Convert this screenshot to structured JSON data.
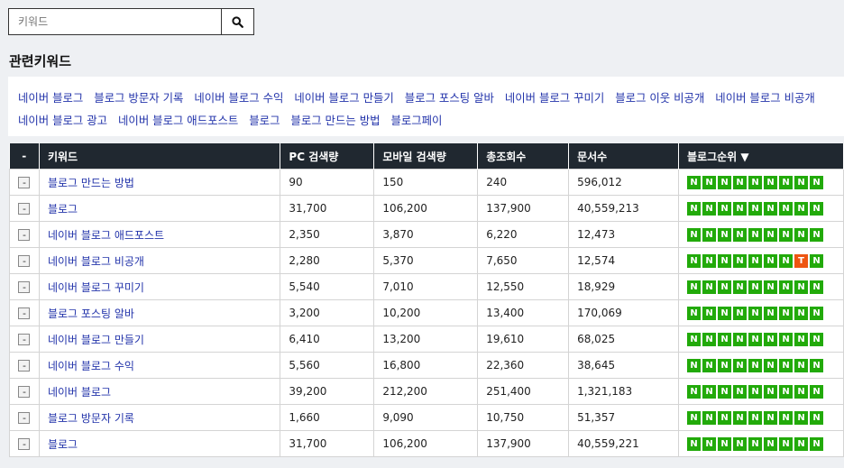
{
  "search": {
    "placeholder": "키워드",
    "button_icon": "search-icon"
  },
  "section_title": "관련키워드",
  "related_keywords": [
    "네이버 블로그",
    "블로그 방문자 기록",
    "네이버 블로그 수익",
    "네이버 블로그 만들기",
    "블로그 포스팅 알바",
    "네이버 블로그 꾸미기",
    "블로그 이웃 비공개",
    "네이버 블로그 비공개",
    "네이버 블로그 광고",
    "네이버 블로그 애드포스트",
    "블로그",
    "블로그 만드는 방법",
    "블로그페이"
  ],
  "table": {
    "headers": {
      "col0": "-",
      "keyword": "키워드",
      "pc": "PC 검색량",
      "mobile": "모바일 검색량",
      "total": "총조회수",
      "docs": "문서수",
      "rank": "블로그순위 ▼"
    },
    "rows": [
      {
        "keyword": "블로그 만드는 방법",
        "pc": "90",
        "mobile": "150",
        "total": "240",
        "docs": "596,012",
        "ranks": [
          "N",
          "N",
          "N",
          "N",
          "N",
          "N",
          "N",
          "N",
          "N"
        ]
      },
      {
        "keyword": "블로그",
        "pc": "31,700",
        "mobile": "106,200",
        "total": "137,900",
        "docs": "40,559,213",
        "ranks": [
          "N",
          "N",
          "N",
          "N",
          "N",
          "N",
          "N",
          "N",
          "N"
        ]
      },
      {
        "keyword": "네이버 블로그 애드포스트",
        "pc": "2,350",
        "mobile": "3,870",
        "total": "6,220",
        "docs": "12,473",
        "ranks": [
          "N",
          "N",
          "N",
          "N",
          "N",
          "N",
          "N",
          "N",
          "N"
        ]
      },
      {
        "keyword": "네이버 블로그 비공개",
        "pc": "2,280",
        "mobile": "5,370",
        "total": "7,650",
        "docs": "12,574",
        "ranks": [
          "N",
          "N",
          "N",
          "N",
          "N",
          "N",
          "N",
          "T",
          "N"
        ]
      },
      {
        "keyword": "네이버 블로그 꾸미기",
        "pc": "5,540",
        "mobile": "7,010",
        "total": "12,550",
        "docs": "18,929",
        "ranks": [
          "N",
          "N",
          "N",
          "N",
          "N",
          "N",
          "N",
          "N",
          "N"
        ]
      },
      {
        "keyword": "블로그 포스팅 알바",
        "pc": "3,200",
        "mobile": "10,200",
        "total": "13,400",
        "docs": "170,069",
        "ranks": [
          "N",
          "N",
          "N",
          "N",
          "N",
          "N",
          "N",
          "N",
          "N"
        ]
      },
      {
        "keyword": "네이버 블로그 만들기",
        "pc": "6,410",
        "mobile": "13,200",
        "total": "19,610",
        "docs": "68,025",
        "ranks": [
          "N",
          "N",
          "N",
          "N",
          "N",
          "N",
          "N",
          "N",
          "N"
        ]
      },
      {
        "keyword": "네이버 블로그 수익",
        "pc": "5,560",
        "mobile": "16,800",
        "total": "22,360",
        "docs": "38,645",
        "ranks": [
          "N",
          "N",
          "N",
          "N",
          "N",
          "N",
          "N",
          "N",
          "N"
        ]
      },
      {
        "keyword": "네이버 블로그",
        "pc": "39,200",
        "mobile": "212,200",
        "total": "251,400",
        "docs": "1,321,183",
        "ranks": [
          "N",
          "N",
          "N",
          "N",
          "N",
          "N",
          "N",
          "N",
          "N"
        ]
      },
      {
        "keyword": "블로그 방문자 기록",
        "pc": "1,660",
        "mobile": "9,090",
        "total": "10,750",
        "docs": "51,357",
        "ranks": [
          "N",
          "N",
          "N",
          "N",
          "N",
          "N",
          "N",
          "N",
          "N"
        ]
      },
      {
        "keyword": "블로그",
        "pc": "31,700",
        "mobile": "106,200",
        "total": "137,900",
        "docs": "40,559,221",
        "ranks": [
          "N",
          "N",
          "N",
          "N",
          "N",
          "N",
          "N",
          "N",
          "N"
        ]
      }
    ],
    "row_action_label": "-"
  },
  "colors": {
    "rank_n": "#22aa0a",
    "rank_t": "#ee5511",
    "header_bg": "#202830",
    "link": "#2233aa"
  }
}
